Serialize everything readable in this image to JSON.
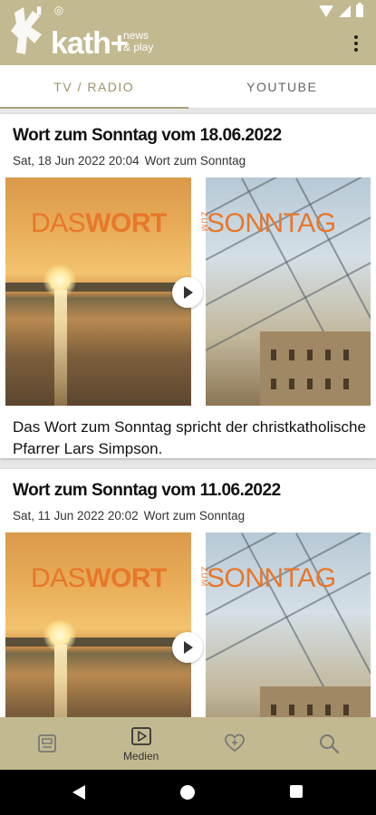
{
  "app": {
    "logo_text": "kath",
    "logo_plus": "+",
    "logo_sub_line1": "news",
    "logo_sub_line2": "& play"
  },
  "tabs": [
    {
      "label": "TV / RADIO",
      "active": true
    },
    {
      "label": "YOUTUBE",
      "active": false
    }
  ],
  "items": [
    {
      "title": "Wort zum Sonntag vom 18.06.2022",
      "date": "Sat, 18 Jun 2022 20:04",
      "category": "Wort zum Sonntag",
      "description": "Das Wort zum Sonntag spricht der christkatholische Pfarrer Lars Simpson.",
      "thumbnail": {
        "das": "DAS",
        "wort": "WORT",
        "zum": "ZUM",
        "sonntag": "SONNTAG"
      }
    },
    {
      "title": "Wort zum Sonntag vom 11.06.2022",
      "date": "Sat, 11 Jun 2022 20:02",
      "category": "Wort zum Sonntag",
      "description": "",
      "thumbnail": {
        "das": "DAS",
        "wort": "WORT",
        "zum": "ZUM",
        "sonntag": "SONNTAG"
      }
    }
  ],
  "bottom_nav": [
    {
      "icon": "news-icon",
      "label": ""
    },
    {
      "icon": "play-icon",
      "label": "Medien",
      "active": true
    },
    {
      "icon": "heart-plus-icon",
      "label": ""
    },
    {
      "icon": "search-icon",
      "label": ""
    }
  ],
  "colors": {
    "bar": "#c3b990",
    "accent": "#a8a07a",
    "logo_orange": "#e8772a"
  }
}
